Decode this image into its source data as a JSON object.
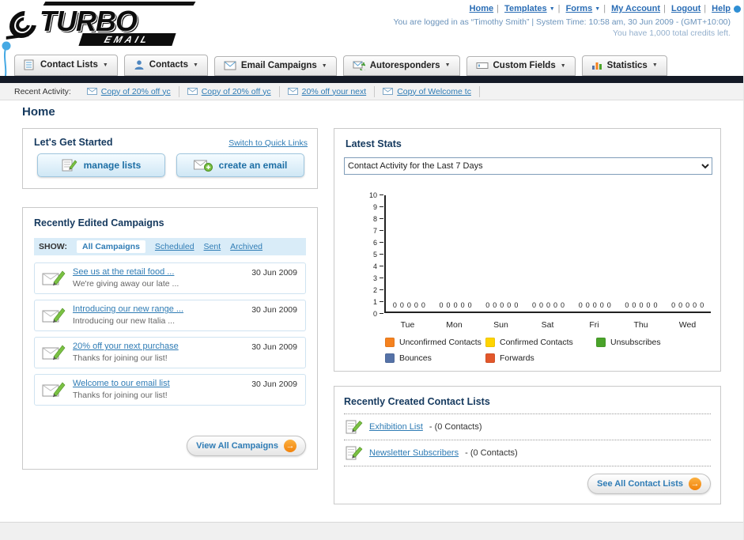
{
  "brand": {
    "title": "TURBO",
    "subtitle": "EMAIL"
  },
  "header": {
    "links": [
      "Home",
      "Templates",
      "Forms",
      "My Account",
      "Logout",
      "Help"
    ],
    "session_line": "You are logged in as “Timothy Smith” | System Time: 10:58 am, 30 Jun 2009 - (GMT+10:00)",
    "credits_line": "You have 1,000 total credits left."
  },
  "main_nav": {
    "items": [
      {
        "label": "Contact Lists"
      },
      {
        "label": "Contacts"
      },
      {
        "label": "Email Campaigns"
      },
      {
        "label": "Autoresponders"
      },
      {
        "label": "Custom Fields"
      },
      {
        "label": "Statistics"
      }
    ]
  },
  "recent_activity": {
    "label": "Recent Activity:",
    "items": [
      "Copy of 20% off yc",
      "Copy of 20% off yc",
      "20% off your next",
      "Copy of Welcome tc"
    ]
  },
  "page": {
    "title": "Home"
  },
  "get_started": {
    "title": "Let's Get Started",
    "switch_link": "Switch to Quick Links",
    "buttons": [
      {
        "label": "manage lists"
      },
      {
        "label": "create an email"
      }
    ]
  },
  "campaigns": {
    "title": "Recently Edited Campaigns",
    "show_label": "SHOW:",
    "tabs": [
      "All Campaigns",
      "Scheduled",
      "Sent",
      "Archived"
    ],
    "selected_tab": "All Campaigns",
    "items": [
      {
        "title": "See us at the retail food ...",
        "subtitle": "We're giving away our late ...",
        "date": "30 Jun 2009"
      },
      {
        "title": "Introducing our new range ...",
        "subtitle": "Introducing our new Italia ...",
        "date": "30 Jun 2009"
      },
      {
        "title": "20% off your next purchase",
        "subtitle": "Thanks for joining our list!",
        "date": "30 Jun 2009"
      },
      {
        "title": "Welcome to our email list",
        "subtitle": "Thanks for joining our list!",
        "date": "30 Jun 2009"
      }
    ],
    "view_all_label": "View All Campaigns"
  },
  "stats": {
    "title": "Latest Stats",
    "dropdown_value": "Contact Activity for the Last 7 Days",
    "chart_data": {
      "type": "bar",
      "title": "Contact Activity for the Last 7 Days",
      "categories": [
        "Tue",
        "Mon",
        "Sun",
        "Sat",
        "Fri",
        "Thu",
        "Wed"
      ],
      "series": [
        {
          "name": "Unconfirmed Contacts",
          "color": "#f5821f",
          "values": [
            0,
            0,
            0,
            0,
            0,
            0,
            0
          ]
        },
        {
          "name": "Confirmed Contacts",
          "color": "#ffd400",
          "values": [
            0,
            0,
            0,
            0,
            0,
            0,
            0
          ]
        },
        {
          "name": "Unsubscribes",
          "color": "#4aa32a",
          "values": [
            0,
            0,
            0,
            0,
            0,
            0,
            0
          ]
        },
        {
          "name": "Bounces",
          "color": "#5572a7",
          "values": [
            0,
            0,
            0,
            0,
            0,
            0,
            0
          ]
        },
        {
          "name": "Forwards",
          "color": "#e2572b",
          "values": [
            0,
            0,
            0,
            0,
            0,
            0,
            0
          ]
        }
      ],
      "ylim": [
        0,
        10
      ],
      "yticks": [
        0,
        1,
        2,
        3,
        4,
        5,
        6,
        7,
        8,
        9,
        10
      ],
      "grid": false,
      "legend_position": "bottom"
    }
  },
  "contact_lists": {
    "title": "Recently Created Contact Lists",
    "items": [
      {
        "name": "Exhibition List",
        "detail": "- (0 Contacts)"
      },
      {
        "name": "Newsletter Subscribers",
        "detail": "- (0 Contacts)"
      }
    ],
    "see_all_label": "See All Contact Lists"
  },
  "colors": {
    "link": "#2f7cb5",
    "heading": "#15395e",
    "arrow_circle": "#f7941d",
    "nav_bar": "#141a26"
  }
}
